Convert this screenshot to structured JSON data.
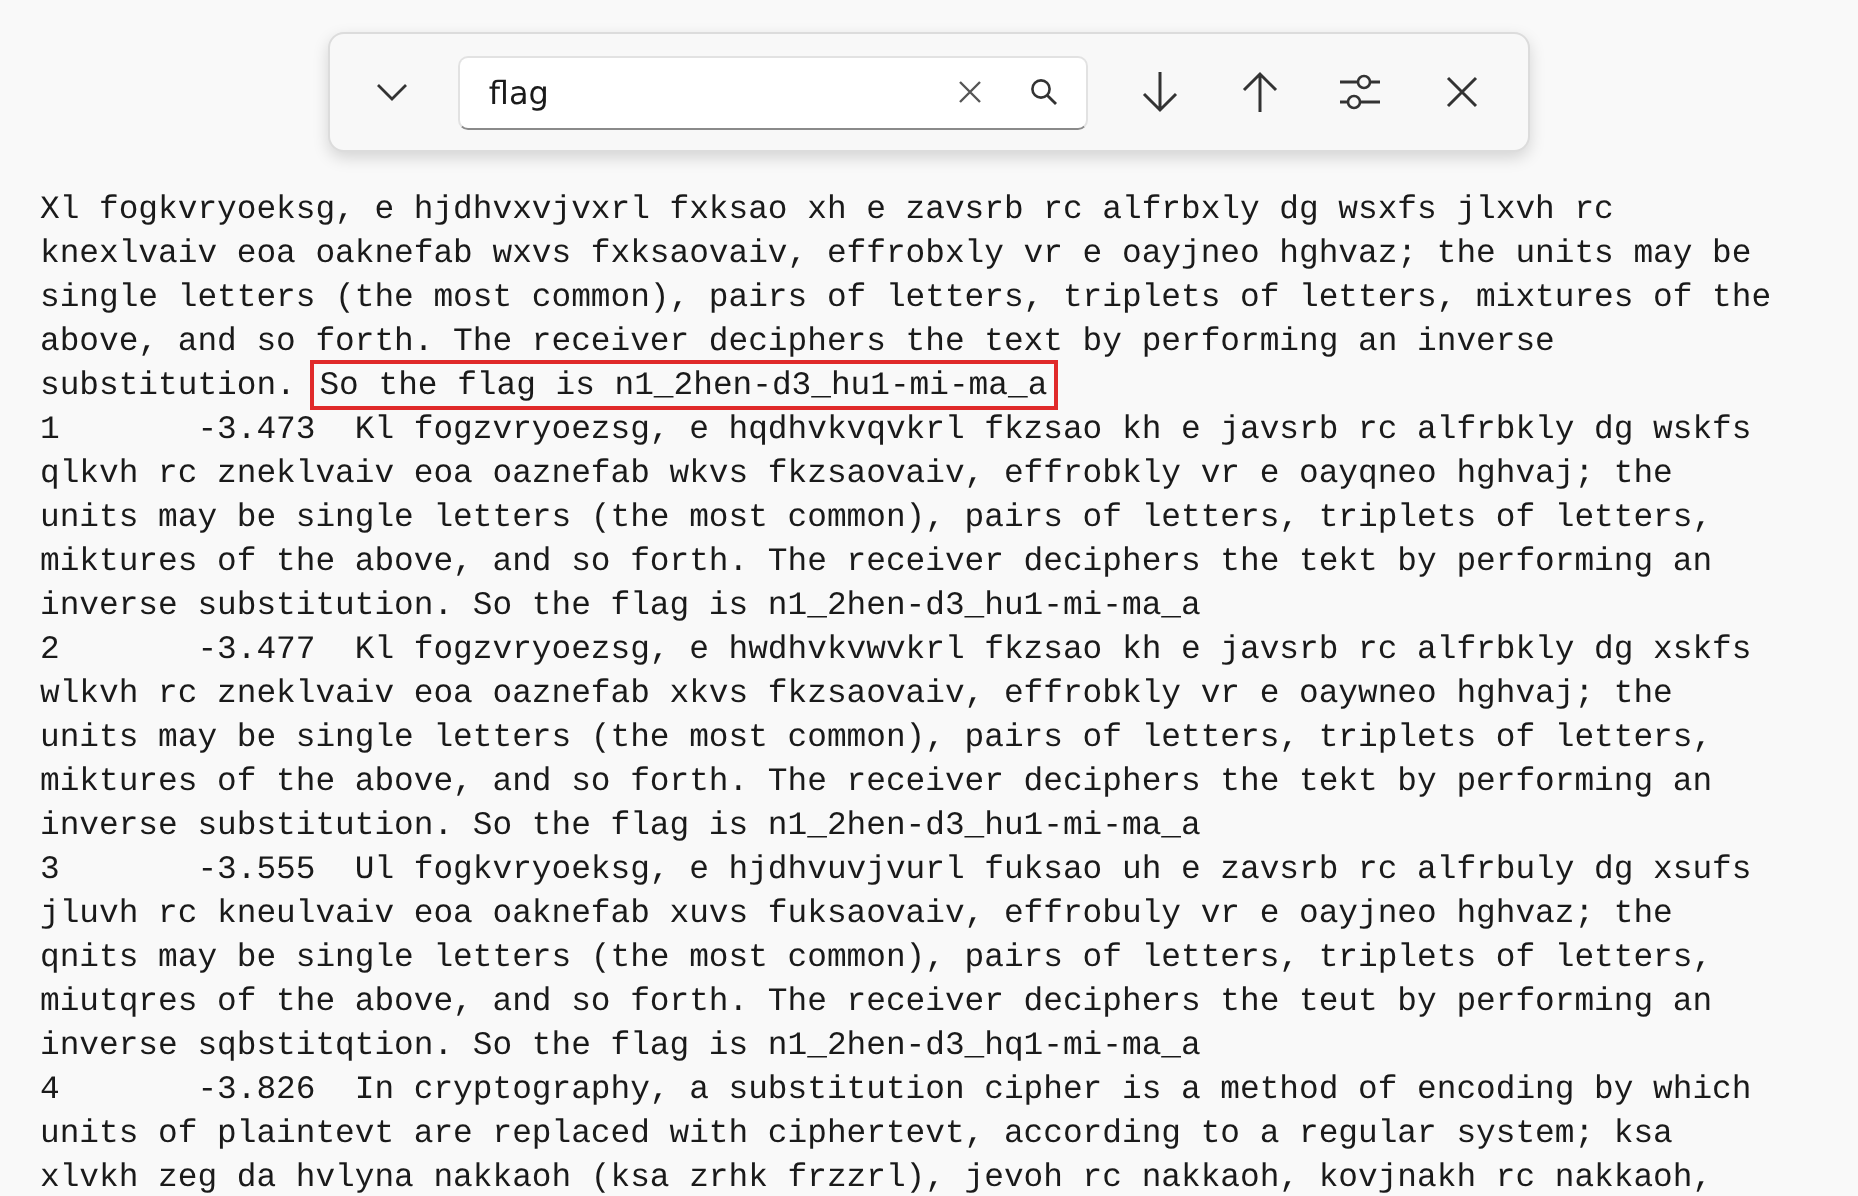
{
  "find_bar": {
    "query": "flag"
  },
  "lines": [
    {
      "segments": [
        {
          "kind": "plain",
          "text": "Xl fogkvryoeksg, e hjdhvxvjvxrl fxksao xh e zavsrb rc alfrbxly dg wsxfs jlxvh rc"
        }
      ]
    },
    {
      "segments": [
        {
          "kind": "plain",
          "text": "knexlvaiv eoa oaknefab wxvs fxksaovaiv, effrobxly vr e oayjneo hghvaz; the units may be"
        }
      ]
    },
    {
      "segments": [
        {
          "kind": "plain",
          "text": "single letters (the most common), pairs of letters, triplets of letters, mixtures of the"
        }
      ]
    },
    {
      "segments": [
        {
          "kind": "plain",
          "text": "above, and so forth. The receiver deciphers the text by performing an inverse"
        }
      ]
    },
    {
      "segments": [
        {
          "kind": "plain",
          "text": "substitution. "
        },
        {
          "kind": "highlight",
          "text": "So the flag is n1_2hen-d3_hu1-mi-ma_a"
        }
      ]
    },
    {
      "segments": [
        {
          "kind": "plain",
          "text": "1       -3.473  Kl fogzvryoezsg, e hqdhvkvqvkrl fkzsao kh e javsrb rc alfrbkly dg wskfs"
        }
      ]
    },
    {
      "segments": [
        {
          "kind": "plain",
          "text": "qlkvh rc zneklvaiv eoa oaznefab wkvs fkzsaovaiv, effrobkly vr e oayqneo hghvaj; the"
        }
      ]
    },
    {
      "segments": [
        {
          "kind": "plain",
          "text": "units may be single letters (the most common), pairs of letters, triplets of letters,"
        }
      ]
    },
    {
      "segments": [
        {
          "kind": "plain",
          "text": "miktures of the above, and so forth. The receiver deciphers the tekt by performing an"
        }
      ]
    },
    {
      "segments": [
        {
          "kind": "plain",
          "text": "inverse substitution. So the flag is n1_2hen-d3_hu1-mi-ma_a"
        }
      ]
    },
    {
      "segments": [
        {
          "kind": "plain",
          "text": "2       -3.477  Kl fogzvryoezsg, e hwdhvkvwvkrl fkzsao kh e javsrb rc alfrbkly dg xskfs"
        }
      ]
    },
    {
      "segments": [
        {
          "kind": "plain",
          "text": "wlkvh rc zneklvaiv eoa oaznefab xkvs fkzsaovaiv, effrobkly vr e oaywneo hghvaj; the"
        }
      ]
    },
    {
      "segments": [
        {
          "kind": "plain",
          "text": "units may be single letters (the most common), pairs of letters, triplets of letters,"
        }
      ]
    },
    {
      "segments": [
        {
          "kind": "plain",
          "text": "miktures of the above, and so forth. The receiver deciphers the tekt by performing an"
        }
      ]
    },
    {
      "segments": [
        {
          "kind": "plain",
          "text": "inverse substitution. So the flag is n1_2hen-d3_hu1-mi-ma_a"
        }
      ]
    },
    {
      "segments": [
        {
          "kind": "plain",
          "text": "3       -3.555  Ul fogkvryoeksg, e hjdhvuvjvurl fuksao uh e zavsrb rc alfrbuly dg xsufs"
        }
      ]
    },
    {
      "segments": [
        {
          "kind": "plain",
          "text": "jluvh rc kneulvaiv eoa oaknefab xuvs fuksaovaiv, effrobuly vr e oayjneo hghvaz; the"
        }
      ]
    },
    {
      "segments": [
        {
          "kind": "plain",
          "text": "qnits may be single letters (the most common), pairs of letters, triplets of letters,"
        }
      ]
    },
    {
      "segments": [
        {
          "kind": "plain",
          "text": "miutqres of the above, and so forth. The receiver deciphers the teut by performing an"
        }
      ]
    },
    {
      "segments": [
        {
          "kind": "plain",
          "text": "inverse sqbstitqtion. So the flag is n1_2hen-d3_hq1-mi-ma_a"
        }
      ]
    },
    {
      "segments": [
        {
          "kind": "plain",
          "text": "4       -3.826  In cryptography, a substitution cipher is a method of encoding by which"
        }
      ]
    },
    {
      "segments": [
        {
          "kind": "plain",
          "text": "units of plaintevt are replaced with ciphertevt, according to a regular system; ksa"
        }
      ]
    },
    {
      "segments": [
        {
          "kind": "plain",
          "text": "xlvkh zeg da hvlyna nakkaoh (ksa zrhk frzzrl), jevoh rc nakkaoh, kovjnakh rc nakkaoh,"
        }
      ]
    }
  ]
}
